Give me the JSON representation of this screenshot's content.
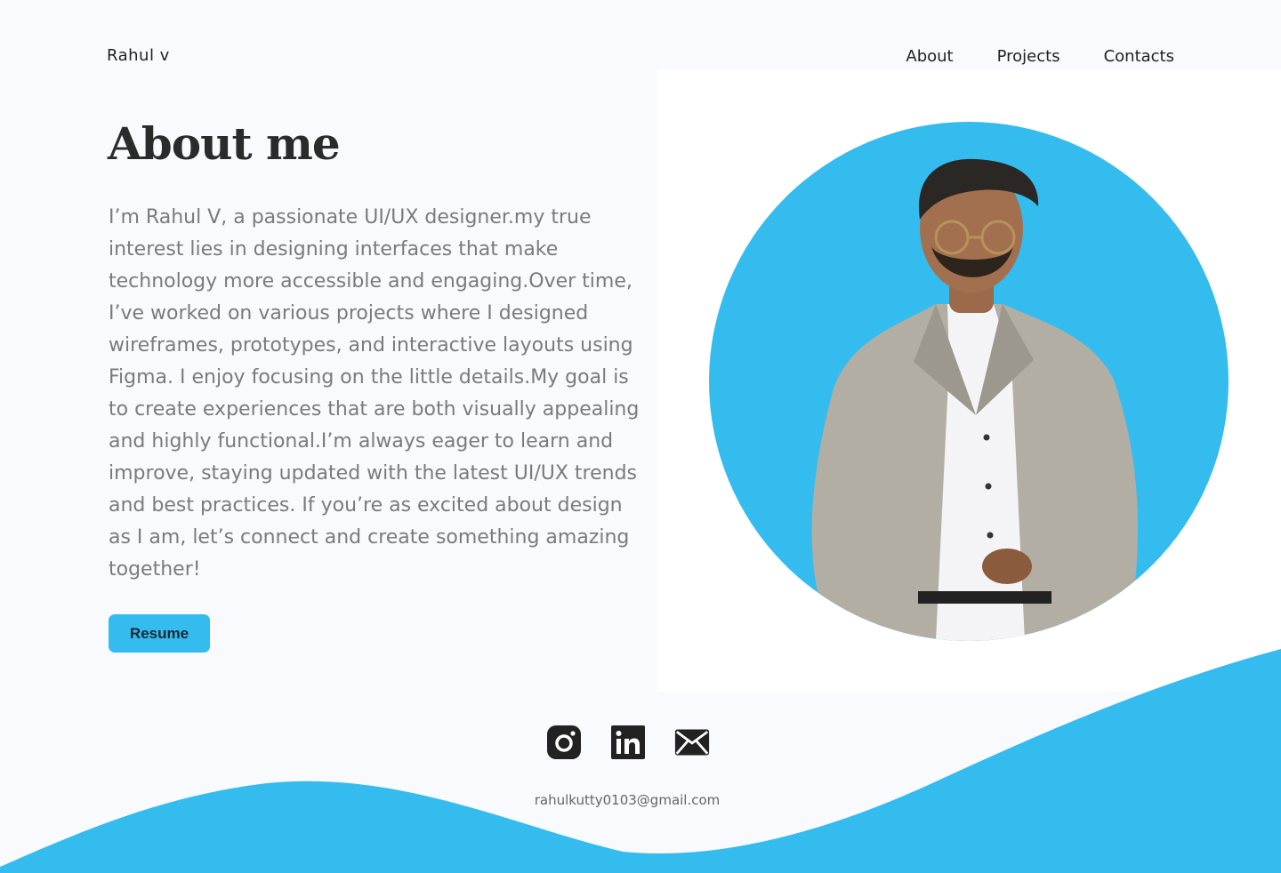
{
  "brand": {
    "name": "Rahul  v"
  },
  "nav": {
    "items": [
      "About",
      "Projects",
      "Contacts"
    ]
  },
  "about": {
    "title": "About me",
    "bio": "I’m Rahul V, a passionate UI/UX designer.my true interest lies in designing interfaces that make technology more accessible and engaging.Over time, I’ve worked on various projects where I designed wireframes, prototypes, and interactive layouts using Figma. I enjoy focusing on the little details.My goal is to create experiences that are both visually appealing and highly functional.I’m always eager to learn and improve, staying updated with the latest UI/UX trends and best practices. If you’re as excited about design as I am, let’s connect and create something amazing together!",
    "resume_label": "Resume"
  },
  "social": {
    "icons": [
      "instagram-icon",
      "linkedin-icon",
      "mail-icon"
    ],
    "email": "rahulkutty0103@gmail.com"
  },
  "colors": {
    "accent": "#34bcef",
    "page_bg": "#f8fafe",
    "panel_bg": "#ffffff",
    "heading": "#2b2b2b",
    "body_text": "#7b7b7b"
  }
}
